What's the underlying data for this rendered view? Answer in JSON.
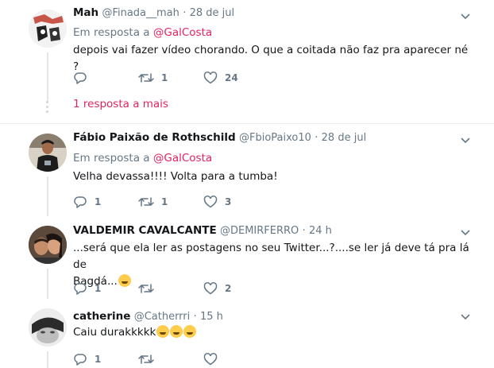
{
  "tweets": [
    {
      "name": "Mah",
      "handle": "@Finada__mah",
      "dot": "·",
      "time": "28 de jul",
      "reply_prefix": "Em resposta a",
      "reply_to": "@GalCosta",
      "text": "depois vai fazer vídeo chorando. O que a coitada não faz pra aparecer né ?",
      "replies": "",
      "retweets": "1",
      "likes": "24",
      "more_replies": "1 resposta a mais"
    },
    {
      "name": "Fábio Paixão de Rothschild",
      "handle": "@FbioPaixo10",
      "dot": "·",
      "time": "28 de jul",
      "reply_prefix": "Em resposta a",
      "reply_to": "@GalCosta",
      "text": "Velha devassa!!!! Volta para a tumba!",
      "replies": "1",
      "retweets": "1",
      "likes": "3"
    },
    {
      "name": "VALDEMIR CAVALCANTE",
      "handle": "@DEMIRFERRO",
      "dot": "·",
      "time": "24 h",
      "text_line1": "...será que ela ler as postagens no seu Twitter...?....se ler já deve tá pra lá de",
      "text_line2": "Bagdá...",
      "emoji_name": "woozy-face-emoji",
      "replies": "1",
      "retweets": "",
      "likes": "2"
    },
    {
      "name": "catherine",
      "handle": "@Catherrri",
      "dot": "·",
      "time": "15 h",
      "text": "Caiu durakkkkk",
      "emoji_names": [
        "grinning-sweat-emoji",
        "joy-emoji",
        "rofl-emoji"
      ],
      "replies": "1",
      "retweets": "",
      "likes": ""
    }
  ],
  "colors": {
    "mention": "#e0245e",
    "secondary": "#657786",
    "divider": "#e6ecf0",
    "thread_line": "#e1e8ed"
  }
}
